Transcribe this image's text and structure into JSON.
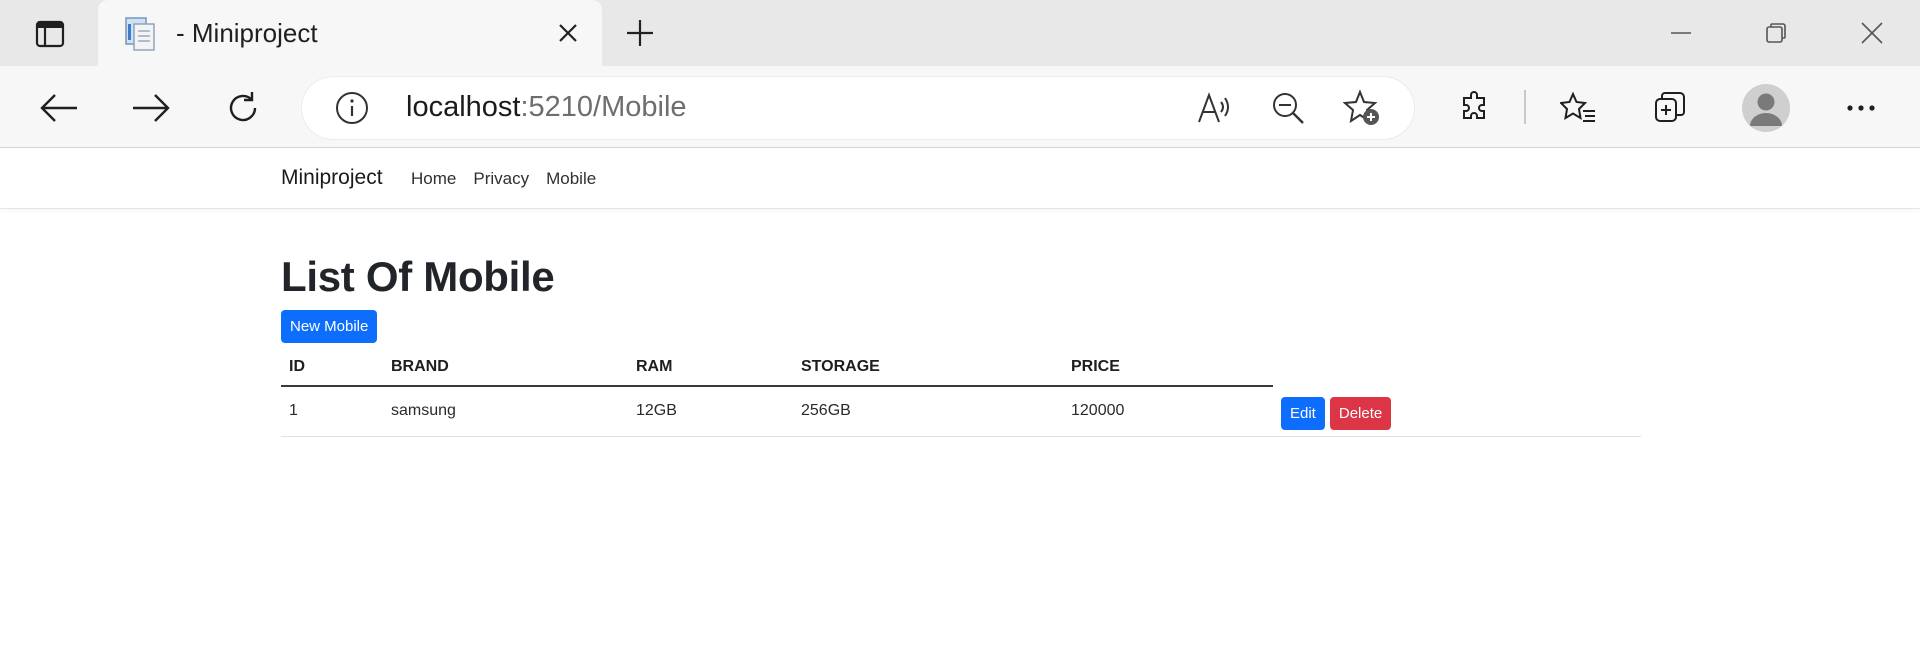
{
  "browser": {
    "tab_title": "- Miniproject",
    "url_host": "localhost",
    "url_rest": ":5210/Mobile"
  },
  "navbar": {
    "brand": "Miniproject",
    "links": [
      "Home",
      "Privacy",
      "Mobile"
    ]
  },
  "page": {
    "heading": "List Of Mobile",
    "new_button": "New Mobile"
  },
  "table": {
    "columns": [
      "ID",
      "BRAND",
      "RAM",
      "STORAGE",
      "PRICE"
    ],
    "rows": [
      {
        "id": "1",
        "brand": "samsung",
        "ram": "12GB",
        "storage": "256GB",
        "price": "120000"
      }
    ],
    "edit_label": "Edit",
    "delete_label": "Delete"
  },
  "colors": {
    "primary": "#0d6efd",
    "danger": "#dc3545"
  },
  "icons": [
    "tab-actions-icon",
    "document-icon",
    "close-icon",
    "plus-icon",
    "minimize-icon",
    "restore-icon",
    "window-close-icon",
    "back-arrow-icon",
    "forward-arrow-icon",
    "refresh-icon",
    "info-icon",
    "read-aloud-icon",
    "zoom-out-icon",
    "add-favorite-icon",
    "extensions-icon",
    "favorites-icon",
    "collections-icon",
    "profile-avatar",
    "more-icon"
  ]
}
